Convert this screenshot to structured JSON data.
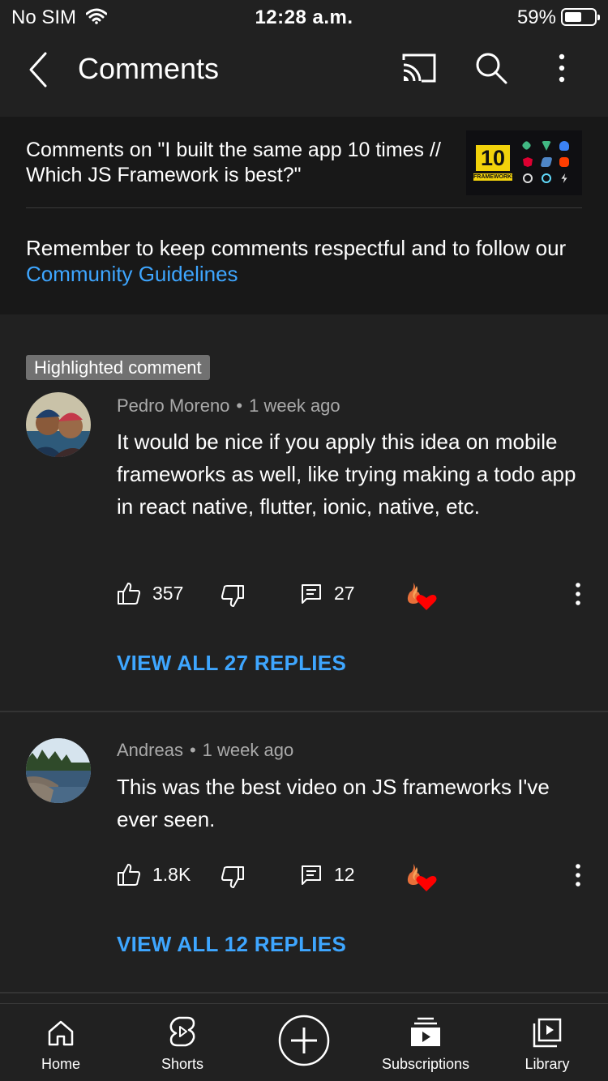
{
  "status_bar": {
    "carrier": "No SIM",
    "time": "12:28 a.m.",
    "battery_percent": "59%",
    "battery_level": 0.59
  },
  "app_bar": {
    "title": "Comments"
  },
  "header": {
    "video_title": "Comments on \"I built the same app 10 times // Which JS Framework is best?\"",
    "thumbnail_number": "10",
    "thumbnail_caption": "FRAMEWORKS",
    "guideline_text": "Remember to keep comments respectful and to follow our ",
    "guideline_link": "Community Guidelines"
  },
  "comments": [
    {
      "badge": "Highlighted comment",
      "author": "Pedro Moreno",
      "separator": "•",
      "time": "1 week ago",
      "text": "It would be nice if you apply this idea on mobile frameworks as well, like trying  making a todo app in react native, flutter, ionic, native, etc.",
      "likes": "357",
      "replies": "27",
      "view_replies": "VIEW ALL 27 REPLIES"
    },
    {
      "author": "Andreas",
      "separator": "•",
      "time": "1 week ago",
      "text": "This was the best video on JS frameworks I've ever seen.",
      "likes": "1.8K",
      "replies": "12",
      "view_replies": "VIEW ALL 12 REPLIES"
    }
  ],
  "bottom_nav": {
    "items": [
      {
        "label": "Home",
        "icon": "home-icon"
      },
      {
        "label": "Shorts",
        "icon": "shorts-icon"
      },
      {
        "label": "",
        "icon": "create-icon"
      },
      {
        "label": "Subscriptions",
        "icon": "subscriptions-icon"
      },
      {
        "label": "Library",
        "icon": "library-icon"
      }
    ]
  },
  "colors": {
    "background": "#212121",
    "panel": "#181818",
    "accent_link": "#3ea6ff",
    "secondary_text": "#aaaaaa",
    "heart": "#ff0000"
  }
}
